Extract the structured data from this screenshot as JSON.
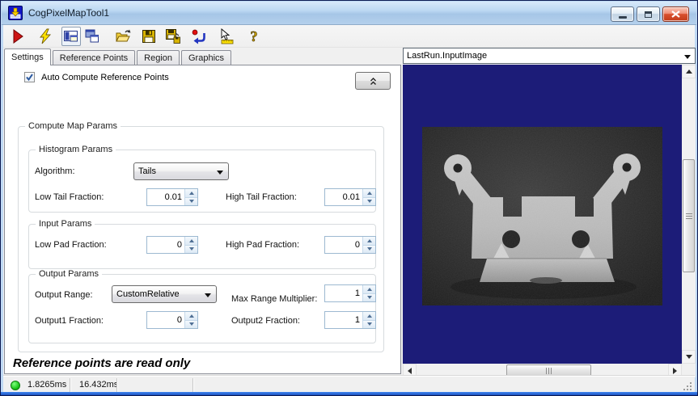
{
  "titlebar": {
    "title": "CogPixelMapTool1"
  },
  "window_controls": {
    "minimize": "minimize",
    "maximize": "maximize",
    "close": "close"
  },
  "toolbar": {
    "icons": [
      "run",
      "electric-run",
      "show-result-toggle",
      "float-window",
      "open-file",
      "save-file",
      "save-as",
      "reset-tool",
      "pointer-measure",
      "help"
    ]
  },
  "tabs": {
    "items": [
      {
        "label": "Settings",
        "active": true
      },
      {
        "label": "Reference Points",
        "active": false
      },
      {
        "label": "Region",
        "active": false
      },
      {
        "label": "Graphics",
        "active": false
      }
    ]
  },
  "settings": {
    "auto_compute_label": "Auto Compute Reference Points",
    "auto_compute_checked": true,
    "compute_map_group": "Compute Map Params",
    "histogram_group": "Histogram Params",
    "algorithm_label": "Algorithm:",
    "algorithm_value": "Tails",
    "low_tail_label": "Low Tail Fraction:",
    "low_tail_value": "0.01",
    "high_tail_label": "High Tail Fraction:",
    "high_tail_value": "0.01",
    "input_group": "Input Params",
    "low_pad_label": "Low Pad Fraction:",
    "low_pad_value": "0",
    "high_pad_label": "High Pad Fraction:",
    "high_pad_value": "0",
    "output_group": "Output Params",
    "output_range_label": "Output Range:",
    "output_range_value": "CustomRelative",
    "max_range_label": "Max Range Multiplier:",
    "max_range_value": "1",
    "output1_label": "Output1 Fraction:",
    "output1_value": "0",
    "output2_label": "Output2 Fraction:",
    "output2_value": "1",
    "message": "Reference points are read only"
  },
  "display": {
    "selector_value": "LastRun.InputImage"
  },
  "statusbar": {
    "time1": "1.8265ms",
    "time2": "16.432ms"
  },
  "colors": {
    "titlebar_blue": "#b7d5f0",
    "canvas_navy": "#1c1c78",
    "close_red": "#d9512f",
    "status_green": "#18c418",
    "metal_gray": "#bdbdbd"
  }
}
